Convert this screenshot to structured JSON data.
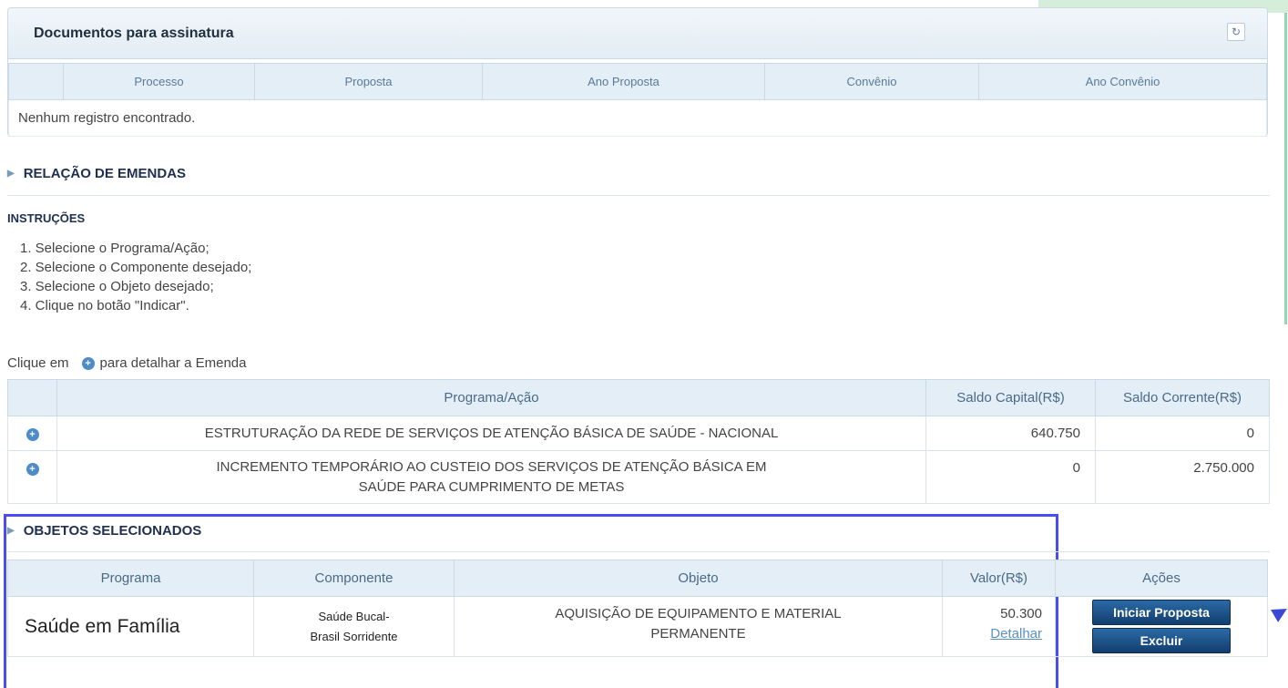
{
  "documents_panel": {
    "title": "Documentos para assinatura",
    "columns": [
      "Processo",
      "Proposta",
      "Ano Proposta",
      "Convênio",
      "Ano Convênio"
    ],
    "empty_message": "Nenhum registro encontrado."
  },
  "relacao": {
    "title": "RELAÇÃO DE EMENDAS",
    "instructions_title": "INSTRUÇÕES",
    "instructions": [
      "1. Selecione o Programa/Ação;",
      "2. Selecione o Componente desejado;",
      "3. Selecione o Objeto desejado;",
      "4. Clique no botão \"Indicar\"."
    ],
    "hint_before": "Clique em",
    "hint_after": "para detalhar a Emenda",
    "columns": [
      "Programa/Ação",
      "Saldo Capital(R$)",
      "Saldo Corrente(R$)"
    ],
    "rows": [
      {
        "programa": "ESTRUTURAÇÃO DA REDE DE SERVIÇOS DE ATENÇÃO BÁSICA DE SAÚDE - NACIONAL",
        "capital": "640.750",
        "corrente": "0"
      },
      {
        "programa": "INCREMENTO TEMPORÁRIO AO CUSTEIO DOS SERVIÇOS DE ATENÇÃO BÁSICA EM SAÚDE PARA CUMPRIMENTO DE METAS",
        "capital": "0",
        "corrente": "2.750.000"
      }
    ]
  },
  "objetos": {
    "title": "OBJETOS SELECIONADOS",
    "columns": [
      "Programa",
      "Componente",
      "Objeto",
      "Valor(R$)",
      "Ações"
    ],
    "row": {
      "programa": "Saúde em Família",
      "componente": "Saúde Bucal-Brasil Sorridente",
      "objeto": "AQUISIÇÃO DE EQUIPAMENTO E MATERIAL PERMANENTE",
      "valor": "50.300",
      "detalhar": "Detalhar"
    },
    "buttons": {
      "iniciar": "Iniciar Proposta",
      "excluir": "Excluir"
    }
  },
  "icons": {
    "expand": "expand-arrow-icon",
    "detail": "plus-circle-icon",
    "collapse": "collapse-icon"
  }
}
